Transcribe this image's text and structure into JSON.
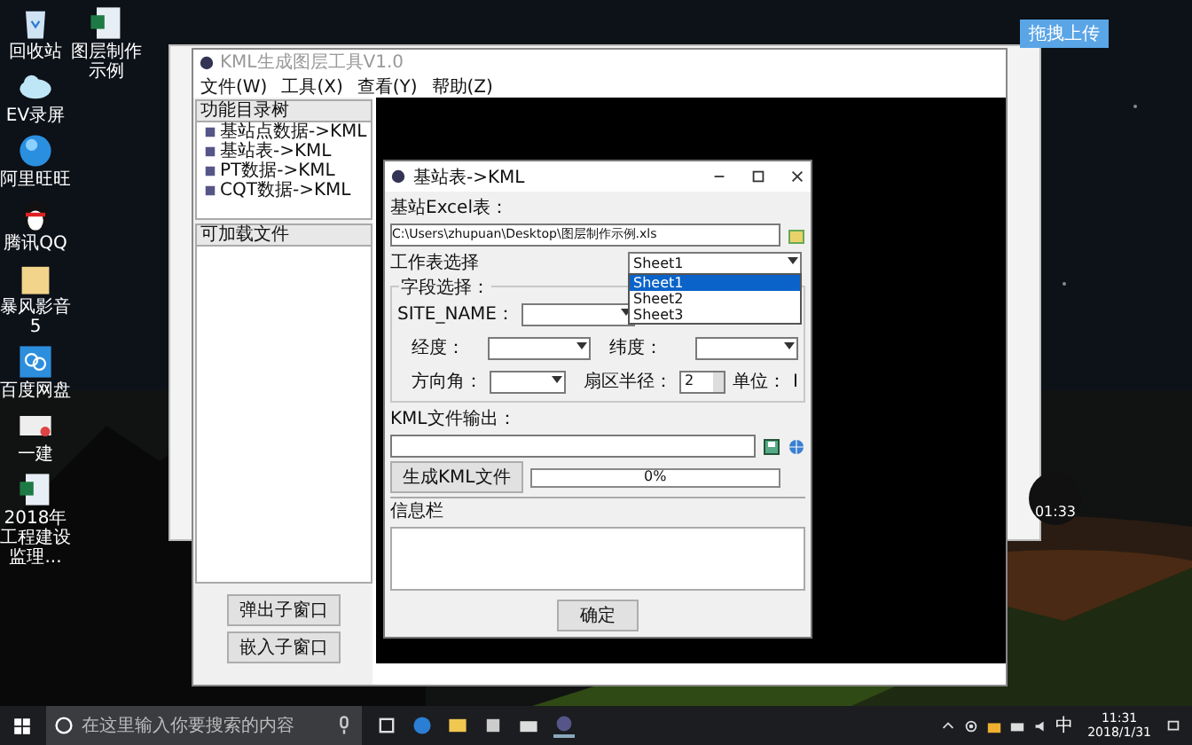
{
  "desktop_icons": [
    {
      "label": "回收站",
      "kind": "recycle"
    },
    {
      "label": "EV录屏",
      "kind": "cloud"
    },
    {
      "label": "阿里旺旺",
      "kind": "bubble"
    },
    {
      "label": "腾讯QQ",
      "kind": "penguin"
    },
    {
      "label": "暴风影音5",
      "kind": "folder"
    },
    {
      "label": "百度网盘",
      "kind": "netdisk"
    },
    {
      "label": "一建",
      "kind": "doc"
    },
    {
      "label": "2018年工程建设监理...",
      "kind": "sheet"
    }
  ],
  "desktop_icons_column_2": [
    {
      "label": "图层制作示例",
      "kind": "sheet"
    }
  ],
  "upload_button": {
    "label": "拖拽上传"
  },
  "main_window": {
    "title": "KML生成图层工具V1.0",
    "menu": [
      "文件(W)",
      "工具(X)",
      "查看(Y)",
      "帮助(Z)"
    ],
    "tree": {
      "title": "功能目录树",
      "items": [
        {
          "label": "基站点数据->KML"
        },
        {
          "label": "基站表->KML"
        },
        {
          "label": "PT数据->KML"
        },
        {
          "label": "CQT数据->KML"
        }
      ]
    },
    "files_panel": {
      "title": "可加载文件"
    },
    "buttons": [
      "弹出子窗口",
      "嵌入子窗口"
    ]
  },
  "dialog": {
    "title": "基站表->KML",
    "excel_label": "基站Excel表：",
    "excel_path": "C:\\Users\\zhupuan\\Desktop\\图层制作示例.xls",
    "sheet_label": "工作表选择",
    "sheet_value": "Sheet1",
    "sheet_options": [
      {
        "label": "Sheet1",
        "selected": true
      },
      {
        "label": "Sheet2",
        "selected": false
      },
      {
        "label": "Sheet3",
        "selected": false
      }
    ],
    "field_group": "字段选择：",
    "site_name_label": "SITE_NAME：",
    "longitude_label": "经度：",
    "latitude_label": "纬度：",
    "azimuth_label": "方向角：",
    "radius_label": "扇区半径：",
    "radius_value": "2",
    "unit_label": "单位：",
    "unit_value": "I",
    "output_label": "KML文件输出：",
    "generate_button": "生成KML文件",
    "progress": {
      "level": 0,
      "text": "0%"
    },
    "info_label": "信息栏",
    "ok_button": "确定"
  },
  "recording_timer": "01:33",
  "taskbar": {
    "search_placeholder": "在这里输入你要搜索的内容",
    "ime": "中",
    "time": "11:31",
    "date": "2018/1/31"
  }
}
